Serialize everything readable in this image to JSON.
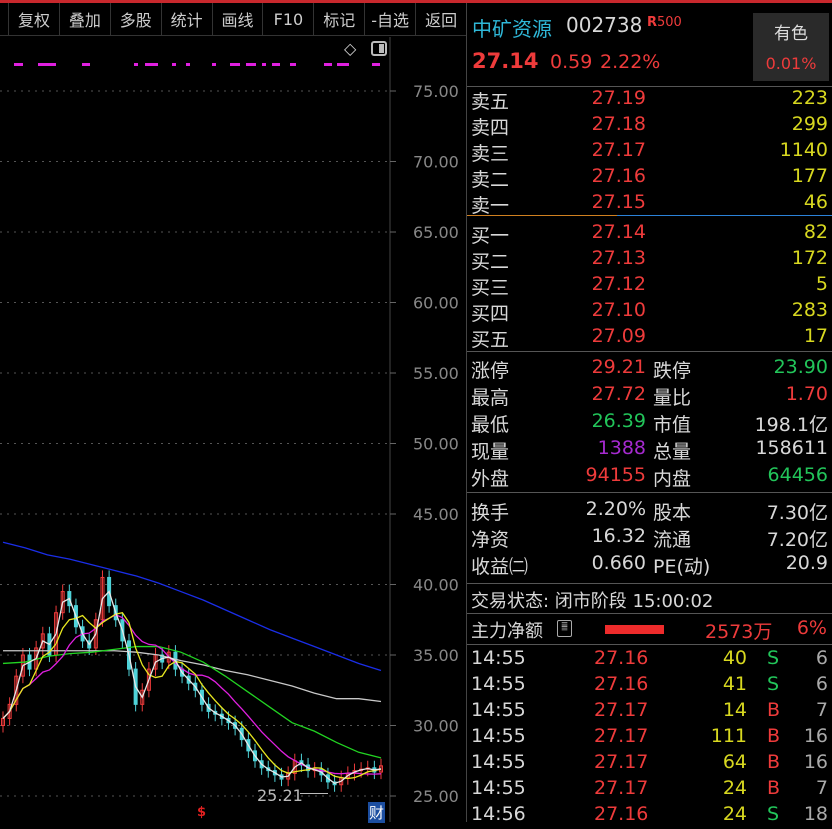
{
  "toolbar": [
    "复权",
    "叠加",
    "多股",
    "统计",
    "画线",
    "F10",
    "标记",
    "-自选",
    "返回"
  ],
  "stock": {
    "name": "中矿资源",
    "code": "002738",
    "badge": "R",
    "badge_num": "500",
    "price": "27.14",
    "change": "0.59",
    "change_pct": "2.22%",
    "sector": "有色",
    "sector_pct": "0.01%"
  },
  "order_book": {
    "asks": [
      {
        "label": "卖五",
        "price": "27.19",
        "vol": "223"
      },
      {
        "label": "卖四",
        "price": "27.18",
        "vol": "299"
      },
      {
        "label": "卖三",
        "price": "27.17",
        "vol": "1140"
      },
      {
        "label": "卖二",
        "price": "27.16",
        "vol": "177"
      },
      {
        "label": "卖一",
        "price": "27.15",
        "vol": "46"
      }
    ],
    "bids": [
      {
        "label": "买一",
        "price": "27.14",
        "vol": "82"
      },
      {
        "label": "买二",
        "price": "27.13",
        "vol": "172"
      },
      {
        "label": "买三",
        "price": "27.12",
        "vol": "5"
      },
      {
        "label": "买四",
        "price": "27.10",
        "vol": "283"
      },
      {
        "label": "买五",
        "price": "27.09",
        "vol": "17"
      }
    ]
  },
  "stats": [
    {
      "l1": "涨停",
      "v1": "29.21",
      "c1": "red",
      "l2": "跌停",
      "v2": "23.90",
      "c2": "green"
    },
    {
      "l1": "最高",
      "v1": "27.72",
      "c1": "red",
      "l2": "量比",
      "v2": "1.70",
      "c2": "red"
    },
    {
      "l1": "最低",
      "v1": "26.39",
      "c1": "green",
      "l2": "市值",
      "v2": "198.1亿",
      "c2": "white"
    },
    {
      "l1": "现量",
      "v1": "1388",
      "c1": "purple",
      "l2": "总量",
      "v2": "158611",
      "c2": "white"
    },
    {
      "l1": "外盘",
      "v1": "94155",
      "c1": "red",
      "l2": "内盘",
      "v2": "64456",
      "c2": "green"
    }
  ],
  "fundamentals": [
    {
      "l1": "换手",
      "v1": "2.20%",
      "l2": "股本",
      "v2": "7.30亿"
    },
    {
      "l1": "净资",
      "v1": "16.32",
      "l2": "流通",
      "v2": "7.20亿"
    },
    {
      "l1": "收益㈡",
      "v1": "0.660",
      "l2": "PE(动)",
      "v2": "20.9"
    }
  ],
  "trade_status": "交易状态: 闭市阶段 15:00:02",
  "main_flow": {
    "label": "主力净额",
    "amount": "2573万",
    "pct": "6%"
  },
  "ticks": [
    {
      "time": "14:55",
      "price": "27.16",
      "vol": "40",
      "side": "S",
      "count": "6"
    },
    {
      "time": "14:55",
      "price": "27.16",
      "vol": "41",
      "side": "S",
      "count": "6"
    },
    {
      "time": "14:55",
      "price": "27.17",
      "vol": "14",
      "side": "B",
      "count": "7"
    },
    {
      "time": "14:55",
      "price": "27.17",
      "vol": "111",
      "side": "B",
      "count": "16"
    },
    {
      "time": "14:55",
      "price": "27.17",
      "vol": "64",
      "side": "B",
      "count": "16"
    },
    {
      "time": "14:55",
      "price": "27.17",
      "vol": "24",
      "side": "B",
      "count": "7"
    },
    {
      "time": "14:56",
      "price": "27.16",
      "vol": "24",
      "side": "S",
      "count": "18"
    }
  ],
  "chart": {
    "y_ticks": [
      "75.00",
      "70.00",
      "65.00",
      "60.00",
      "55.00",
      "50.00",
      "45.00",
      "40.00",
      "35.00",
      "30.00",
      "25.00"
    ],
    "low_label": "25.21",
    "finance_marker": "财",
    "closes": [
      30.5,
      31.5,
      33.5,
      35,
      34,
      35.5,
      36.5,
      35,
      38,
      39.5,
      38.5,
      37,
      36,
      35.5,
      37.5,
      40.5,
      38.5,
      37.5,
      36,
      34,
      31.5,
      32.5,
      34,
      35,
      34.5,
      35.2,
      34,
      33.5,
      33,
      32.5,
      31.5,
      31,
      30.8,
      30.5,
      30.2,
      29.8,
      29,
      28.2,
      27.5,
      27,
      26.8,
      26.5,
      26.2,
      26.6,
      27.5,
      27.2,
      26.8,
      26.9,
      26.5,
      26,
      25.8,
      26.3,
      26.6,
      26.8,
      26.9,
      27,
      26.7,
      27.14
    ],
    "ma_green": [
      34.4,
      34.5,
      34.9,
      35.1,
      35.2,
      35.4,
      35.6,
      35.6,
      35.2,
      34.5,
      33.5,
      32.4,
      31.3,
      30.2,
      29.6,
      28.8,
      28.1,
      27.7
    ],
    "ma_grey": [
      35.3,
      35.3,
      35.3,
      35.3,
      35.3,
      35.3,
      35.2,
      35.0,
      34.6,
      34.3,
      33.9,
      33.6,
      33.2,
      32.8,
      32.3,
      31.9,
      31.9,
      31.7
    ],
    "ma_blue": [
      43.0,
      42.6,
      42.1,
      41.8,
      41.4,
      41.0,
      40.6,
      40.1,
      39.5,
      38.9,
      38.2,
      37.5,
      36.8,
      36.2,
      35.6,
      35.0,
      34.4,
      33.9
    ],
    "colors": {
      "up": "#ee3b3b",
      "down": "#4fd2d8",
      "ma5": "#e8e8e8",
      "ma10": "#e8e820",
      "ma20": "#e020e0",
      "green": "#22d422",
      "grey": "#c8c8c8",
      "blue": "#1a2ee8"
    }
  }
}
